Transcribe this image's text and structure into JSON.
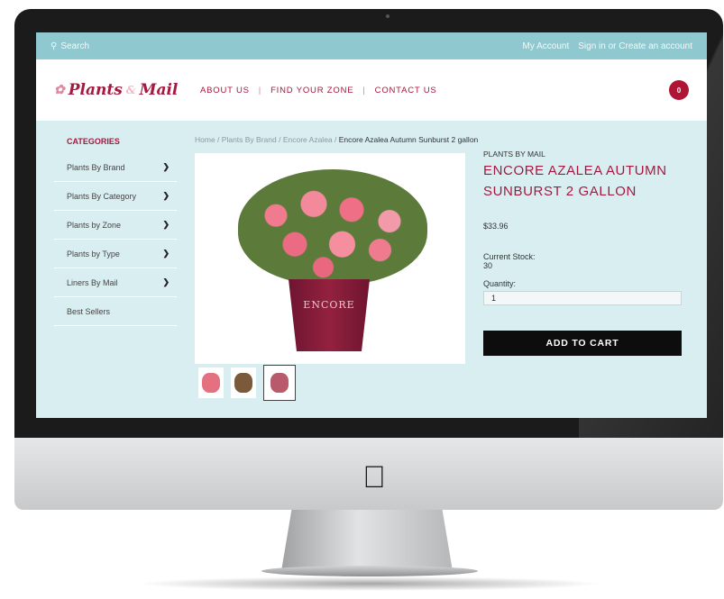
{
  "topbar": {
    "search_label": "Search",
    "account_link": "My Account",
    "signin_link": "Sign in or Create an account"
  },
  "header": {
    "logo_text": "Plants",
    "logo_text2": "Mail",
    "nav": [
      "ABOUT US",
      "FIND YOUR ZONE",
      "CONTACT US"
    ],
    "cart_count": "0"
  },
  "sidebar": {
    "title": "CATEGORIES",
    "items": [
      {
        "label": "Plants By Brand"
      },
      {
        "label": "Plants By Category"
      },
      {
        "label": "Plants by Zone"
      },
      {
        "label": "Plants by Type"
      },
      {
        "label": "Liners By Mail"
      },
      {
        "label": "Best Sellers"
      }
    ]
  },
  "breadcrumb": {
    "items": [
      "Home",
      "Plants By Brand",
      "Encore Azalea"
    ],
    "current": "Encore Azalea Autumn Sunburst 2 gallon"
  },
  "product": {
    "brand": "PLANTS BY MAIL",
    "title": "ENCORE AZALEA AUTUMN SUNBURST 2 GALLON",
    "price": "$33.96",
    "stock_label": "Current Stock:",
    "stock_value": "30",
    "qty_label": "Quantity:",
    "qty_value": "1",
    "add_to_cart": "ADD TO CART",
    "pot_label": "ENCORE"
  },
  "colors": {
    "brand": "#a4193f",
    "topbar": "#8fc9cf",
    "background": "#d9eef1"
  }
}
